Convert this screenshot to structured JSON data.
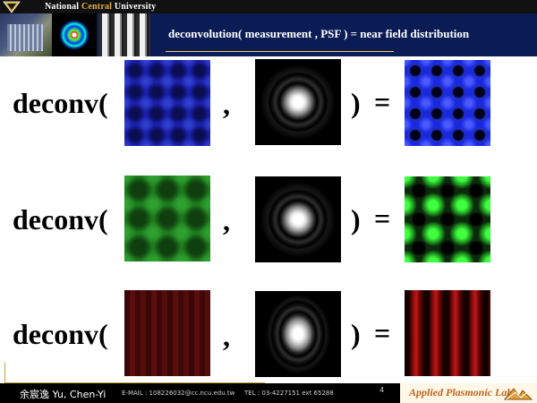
{
  "header": {
    "university_pre": "National ",
    "university_mid": "Central",
    "university_post": " University",
    "title": "deconvolution( measurement , PSF ) = near field distribution"
  },
  "rows": [
    {
      "func_label": "deconv(",
      "comma": ",",
      "close_paren": ")",
      "equals": "=",
      "measurement": "blue-pattern",
      "psf": "circular-psf",
      "result": "blue-near-field"
    },
    {
      "func_label": "deconv(",
      "comma": ",",
      "close_paren": ")",
      "equals": "=",
      "measurement": "green-pattern",
      "psf": "circular-psf",
      "result": "green-near-field"
    },
    {
      "func_label": "deconv(",
      "comma": ",",
      "close_paren": ")",
      "equals": "=",
      "measurement": "red-pattern",
      "psf": "elliptical-psf",
      "result": "red-near-field"
    }
  ],
  "footer": {
    "name": "余宸逸 Yu, Chen-Yi",
    "email": "E-MAIL : 108226032@cc.ncu.edu.tw",
    "tel": "TEL : 03-4227151  ext 65288",
    "page": "4",
    "lab": "Applied Plasmonic Lab"
  },
  "colors": {
    "header_bg": "#0b1c55",
    "footer_bg": "#000000",
    "lab_text": "#c0641a"
  }
}
